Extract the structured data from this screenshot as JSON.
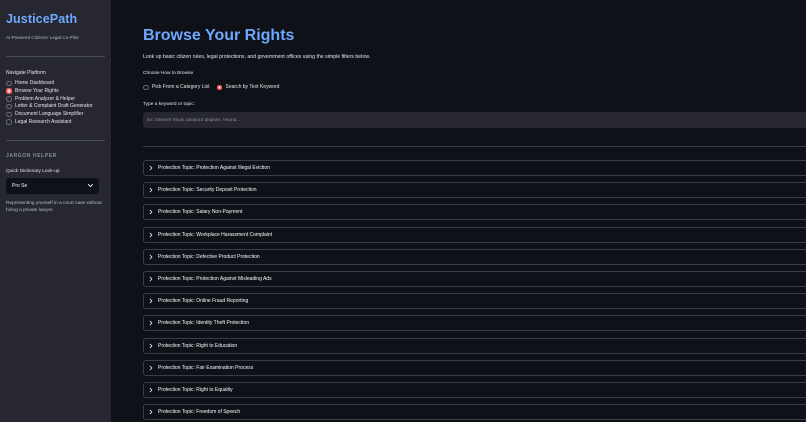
{
  "app": {
    "brand": "JusticePath",
    "tagline": "AI-Powered Citizens' Legal Co-Pilot"
  },
  "sidebar": {
    "nav_label": "Navigate Platform",
    "nav_items": [
      {
        "label": "Home Dashboard",
        "selected": false
      },
      {
        "label": "Browse Your Rights",
        "selected": true
      },
      {
        "label": "Problem Analyzer & Helper",
        "selected": false
      },
      {
        "label": "Letter & Complaint Draft Generator",
        "selected": false
      },
      {
        "label": "Document Language Simplifier",
        "selected": false
      },
      {
        "label": "Legal Research Assistant",
        "selected": false
      }
    ],
    "jargon_heading": "JARGON HELPER",
    "dictionary_label": "Quick Dictionary Look-up",
    "dictionary_selected": "Pro Se",
    "definition": "Representing yourself in a court case without hiring a private lawyer."
  },
  "main": {
    "title": "Browse Your Rights",
    "subtitle": "Look up basic citizen rules, legal protections, and government offices using the simple filters below.",
    "browse_label": "Choose How to Browse",
    "browse_options": [
      {
        "label": "Pick From a Category List",
        "selected": false
      },
      {
        "label": "Search by Text Keyword",
        "selected": true
      }
    ],
    "keyword_label": "Type a keyword or topic:",
    "keyword_placeholder": "Ex: internet fraud, landlord dispute, refund...",
    "topics": [
      "Protection Topic: Protection Against Illegal Eviction",
      "Protection Topic: Security Deposit Protection",
      "Protection Topic: Salary Non-Payment",
      "Protection Topic: Workplace Harassment Complaint",
      "Protection Topic: Defective Product Protection",
      "Protection Topic: Protection Against Misleading Ads",
      "Protection Topic: Online Fraud Reporting",
      "Protection Topic: Identity Theft Protection",
      "Protection Topic: Right to Education",
      "Protection Topic: Fair Examination Process",
      "Protection Topic: Right to Equality",
      "Protection Topic: Freedom of Speech"
    ]
  },
  "colors": {
    "background": "#0e1117",
    "sidebar": "#262730",
    "accent_blue": "#6ea8fe",
    "radio_selected": "#ff4b4b"
  },
  "icons": {
    "expander": "chevron-right-icon",
    "select": "chevron-down-icon"
  }
}
